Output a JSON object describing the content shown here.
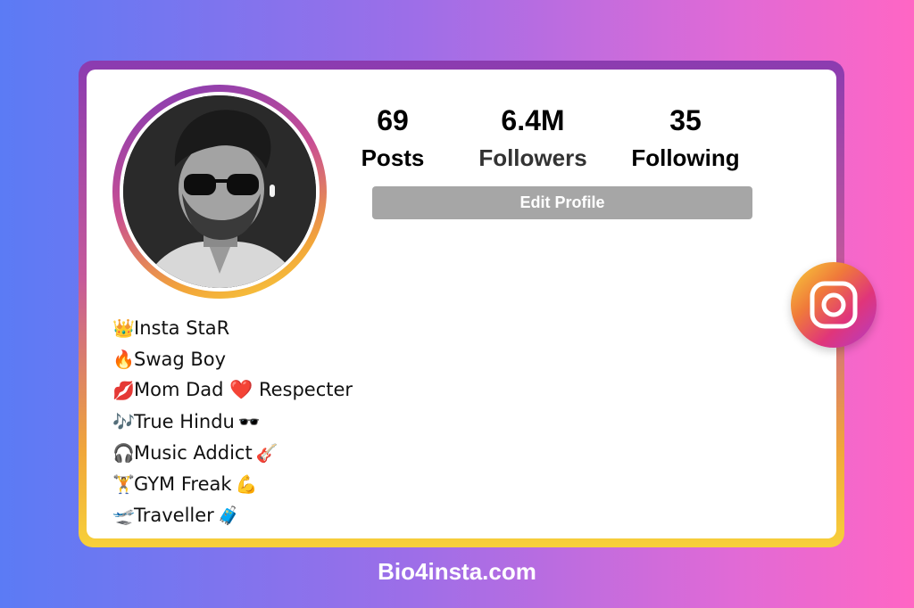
{
  "profile": {
    "stats": {
      "posts": {
        "value": "69",
        "label": "Posts"
      },
      "followers": {
        "value": "6.4M",
        "label": "Followers"
      },
      "following": {
        "value": "35",
        "label": "Following"
      }
    },
    "edit_button_label": "Edit Profile"
  },
  "bio": [
    {
      "emoji": "👑",
      "text": " Insta StaR",
      "trail": ""
    },
    {
      "emoji": "🔥",
      "text": "Swag Boy",
      "trail": ""
    },
    {
      "emoji": "💋",
      "text": "Mom Dad ❤️ Respecter",
      "trail": ""
    },
    {
      "emoji": "🎶",
      "text": "True Hindu",
      "trail": "🕶️"
    },
    {
      "emoji": "🎧",
      "text": "Music Addict",
      "trail": "🎸"
    },
    {
      "emoji": "🏋️",
      "text": "GYM Freak",
      "trail": "💪"
    },
    {
      "emoji": "🛫",
      "text": "Traveller",
      "trail": "🧳"
    }
  ],
  "footer": {
    "site": "Bio4insta.com"
  },
  "icons": {
    "badge": "instagram-icon"
  },
  "colors": {
    "edit_button": "#a6a6a6",
    "ring_start": "#7e3ab6",
    "ring_end": "#f8d23a"
  }
}
